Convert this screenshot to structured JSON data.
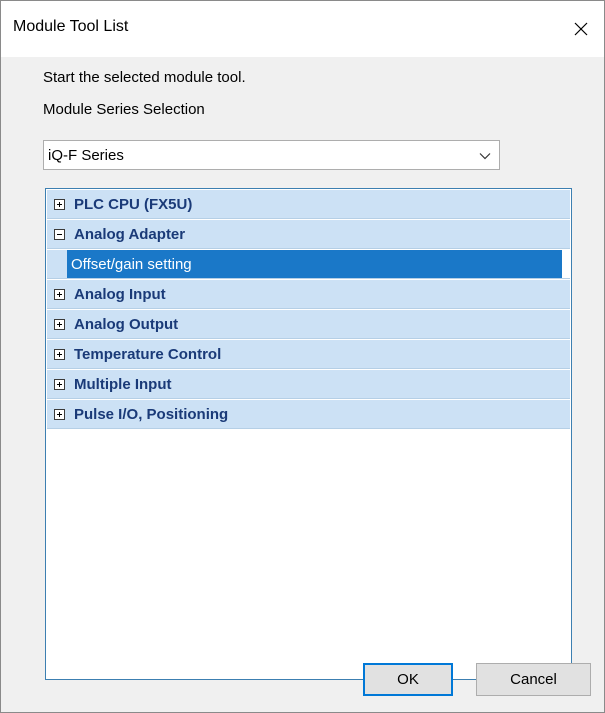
{
  "window": {
    "title": "Module Tool List"
  },
  "instruction": "Start the selected module tool.",
  "series_selection": {
    "label": "Module Series Selection",
    "selected": "iQ-F Series"
  },
  "tree": {
    "items": [
      {
        "label": "PLC CPU (FX5U)",
        "expanded": false
      },
      {
        "label": "Analog Adapter",
        "expanded": true,
        "children": [
          {
            "label": "Offset/gain setting",
            "selected": true
          }
        ]
      },
      {
        "label": "Analog Input",
        "expanded": false
      },
      {
        "label": "Analog Output",
        "expanded": false
      },
      {
        "label": "Temperature Control",
        "expanded": false
      },
      {
        "label": "Multiple Input",
        "expanded": false
      },
      {
        "label": "Pulse I/O, Positioning",
        "expanded": false
      }
    ]
  },
  "buttons": {
    "ok": "OK",
    "cancel": "Cancel"
  },
  "colors": {
    "selection": "#1a78c8",
    "row_highlight": "#cce1f5",
    "tree_text": "#1a3a78",
    "default_button_border": "#0078d7"
  }
}
